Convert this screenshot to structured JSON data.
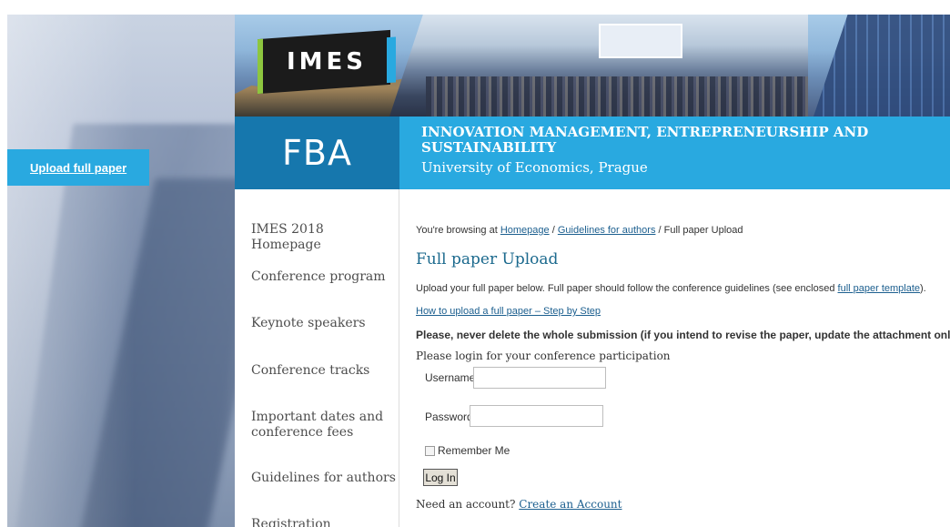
{
  "sidebar": {
    "upload_link": "Upload full paper"
  },
  "header": {
    "logo": "IMES",
    "faculty": "FBA",
    "title": "INNOVATION MANAGEMENT, ENTREPRENEURSHIP AND SUSTAINABILITY",
    "subtitle": "University of Economics, Prague"
  },
  "nav": {
    "items": [
      {
        "label": "IMES 2018 Homepage"
      },
      {
        "label": "Conference program"
      },
      {
        "label": "Keynote speakers"
      },
      {
        "label": "Conference tracks"
      },
      {
        "label": "Important dates and conference fees"
      },
      {
        "label": "Guidelines for authors"
      },
      {
        "label": "Registration"
      }
    ]
  },
  "breadcrumb": {
    "prefix": "You're browsing at",
    "home": "Homepage",
    "sep1": "/",
    "guidelines": "Guidelines for authors",
    "sep2": "/",
    "current": "Full paper Upload"
  },
  "main": {
    "heading": "Full paper Upload",
    "intro_before": "Upload your full paper below. Full paper should follow the conference guidelines (see enclosed",
    "intro_link": "full paper template",
    "intro_after": ").",
    "howto_link": "How to upload a full paper – Step by Step",
    "warning": "Please, never delete the whole submission (if you intend to revise the paper, update the attachment only)",
    "login_prompt": "Please login for your conference participation"
  },
  "login": {
    "username_label": "Username",
    "username_value": "",
    "password_label": "Password",
    "password_value": "",
    "remember_label": "Remember Me",
    "remember_checked": false,
    "submit_label": "Log In",
    "account_prompt": "Need an account?",
    "create_link": "Create an Account"
  },
  "colors": {
    "accent_blue": "#29a9e0",
    "dark_blue": "#1677ad",
    "link": "#1c5f8f",
    "heading": "#1c6a8e",
    "logo_green": "#8dc63f"
  }
}
